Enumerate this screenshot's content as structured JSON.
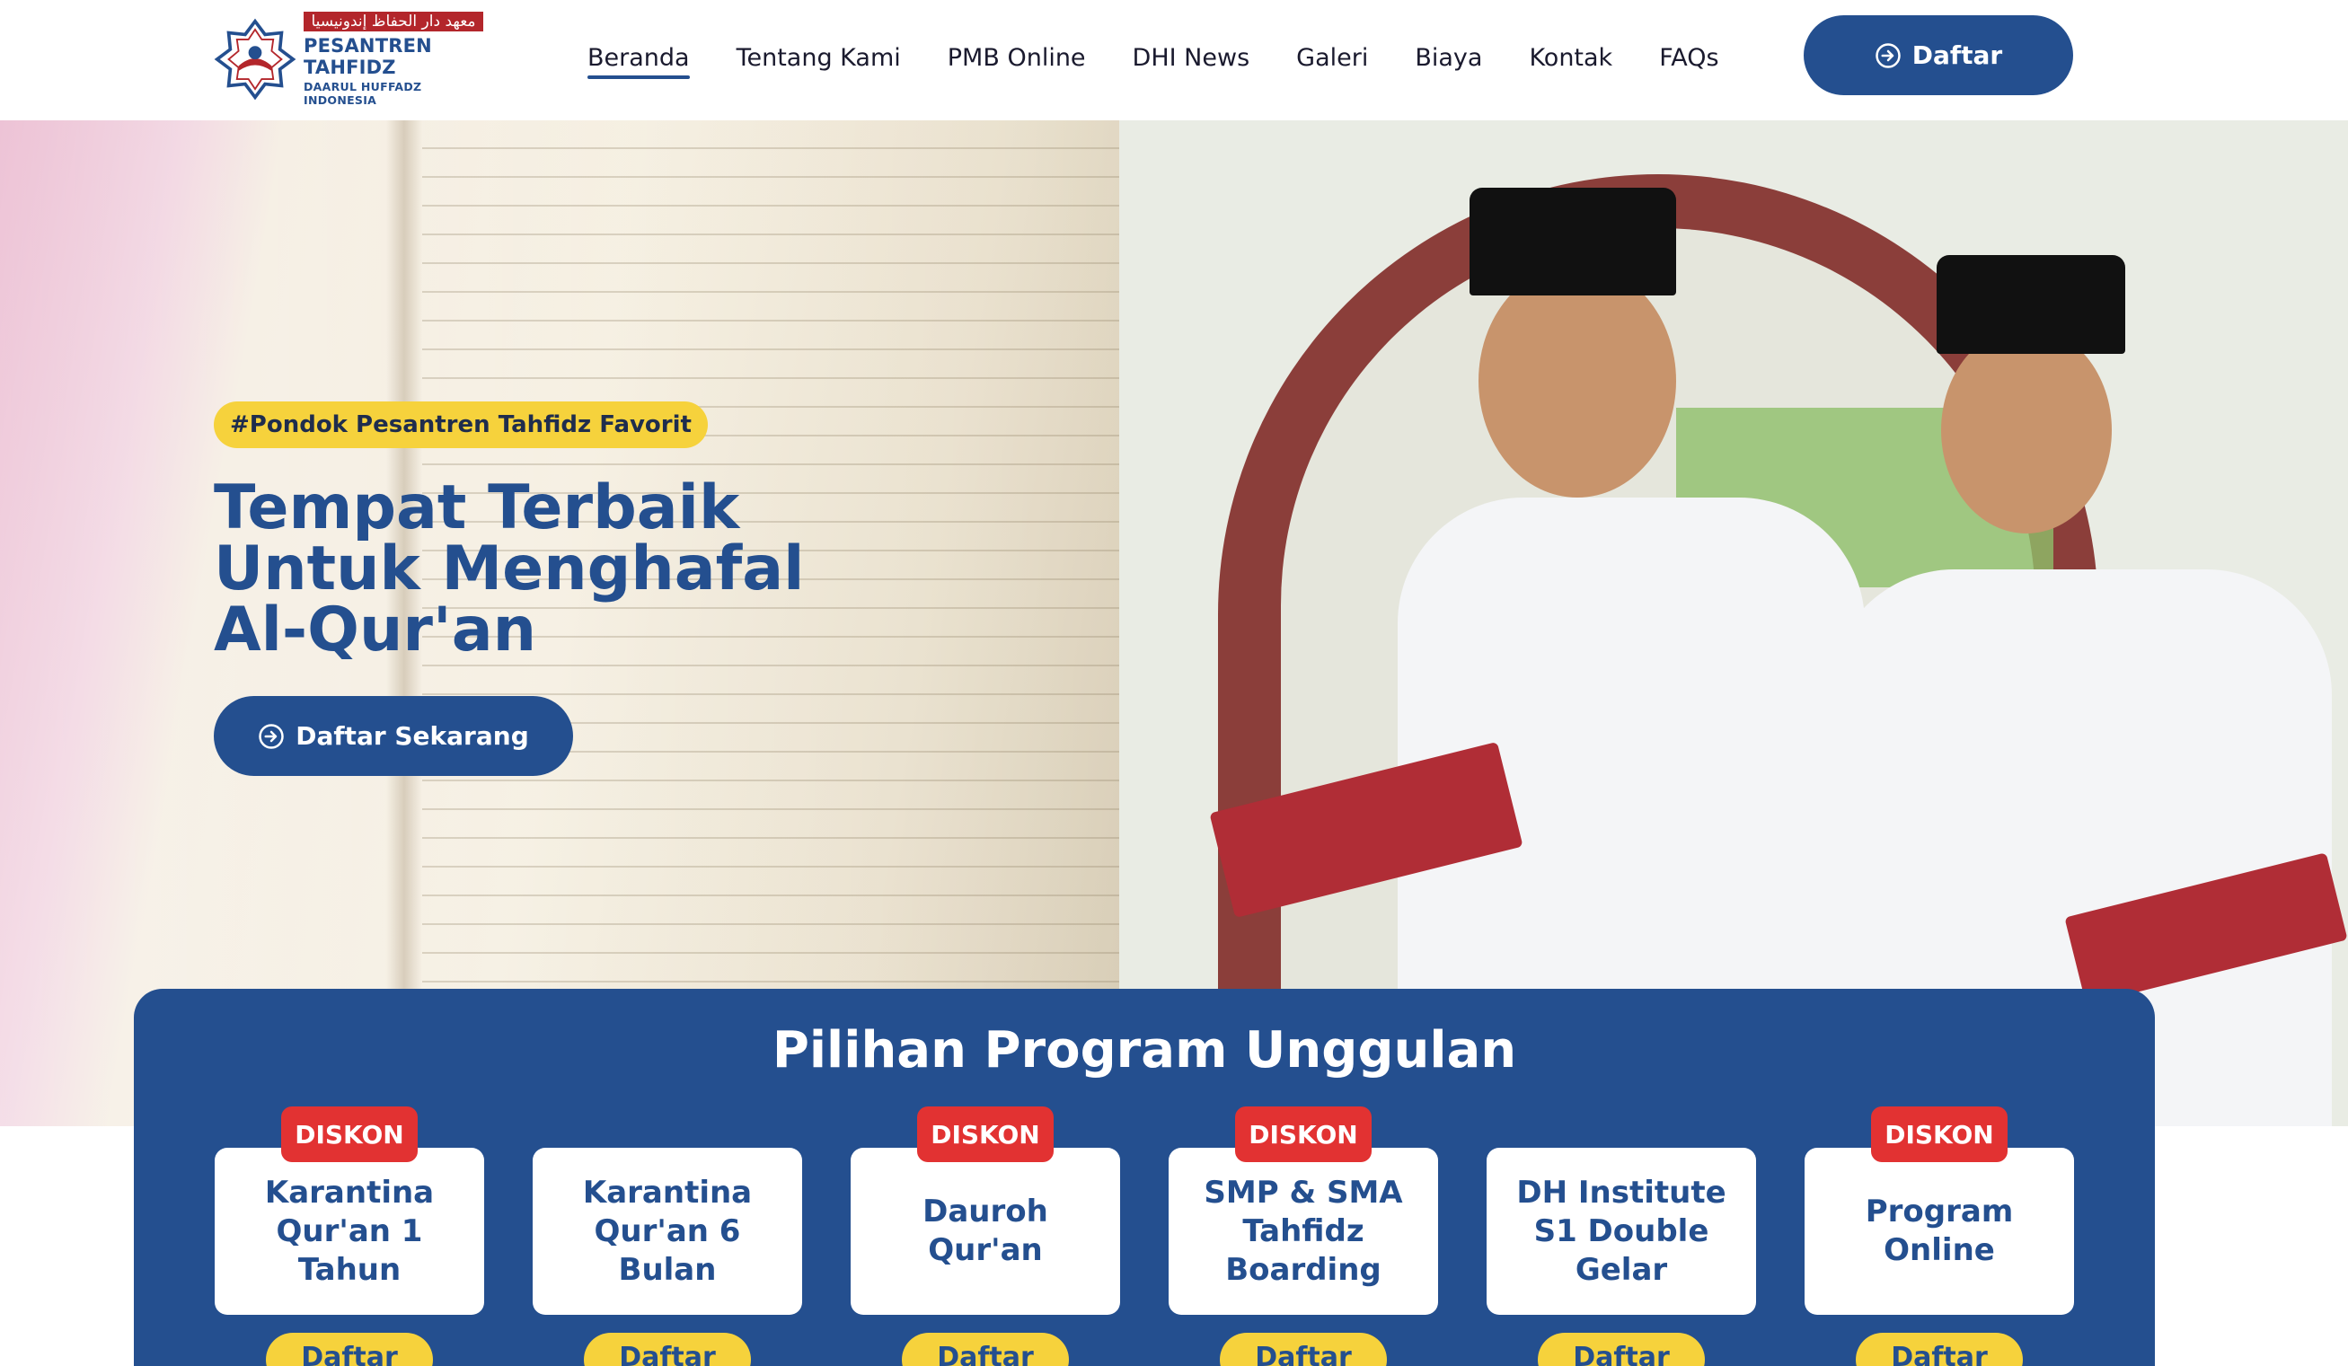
{
  "header": {
    "logo": {
      "arabic": "معهد دار الحفاظ إندونيسيا",
      "name": "PESANTREN TAHFIDZ",
      "subtitle": "DAARUL HUFFADZ INDONESIA"
    },
    "nav": [
      {
        "label": "Beranda",
        "active": true
      },
      {
        "label": "Tentang Kami"
      },
      {
        "label": "PMB Online"
      },
      {
        "label": "DHI News"
      },
      {
        "label": "Galeri"
      },
      {
        "label": "Biaya"
      },
      {
        "label": "Kontak"
      },
      {
        "label": "FAQs"
      }
    ],
    "cta_label": "Daftar"
  },
  "hero": {
    "tag": "#Pondok Pesantren Tahfidz Favorit",
    "title_line1": "Tempat Terbaik",
    "title_line2": "Untuk Menghafal",
    "title_line3": "Al-Qur'an",
    "cta_label": "Daftar Sekarang"
  },
  "programs": {
    "title": "Pilihan Program Unggulan",
    "badge_label": "DISKON",
    "items": [
      {
        "title": "Karantina Qur'an 1 Tahun",
        "discount": true,
        "button": "Daftar"
      },
      {
        "title": "Karantina Qur'an 6 Bulan",
        "discount": false,
        "button": "Daftar"
      },
      {
        "title": "Dauroh Qur'an",
        "discount": true,
        "button": "Daftar"
      },
      {
        "title": "SMP & SMA Tahfidz Boarding",
        "discount": true,
        "button": "Daftar"
      },
      {
        "title": "DH Institute S1 Double Gelar",
        "discount": false,
        "button": "Daftar"
      },
      {
        "title": "Program Online",
        "discount": true,
        "button": "Daftar"
      }
    ]
  },
  "colors": {
    "primary": "#244f8f",
    "accent_yellow": "#f6d23c",
    "badge_red": "#e23232"
  }
}
